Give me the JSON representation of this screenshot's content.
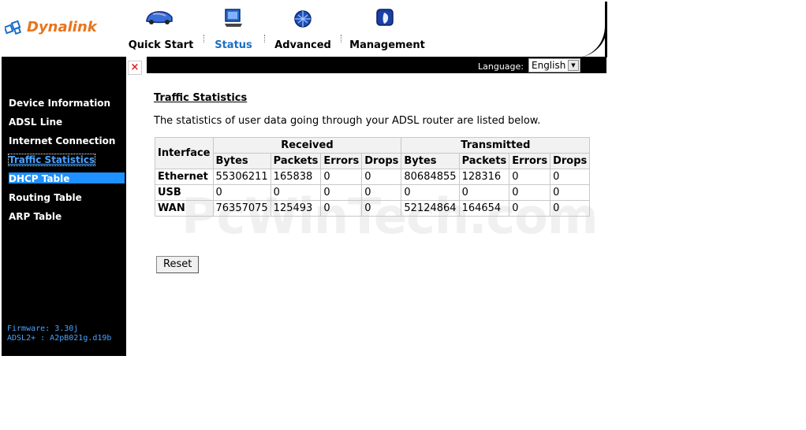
{
  "brand": {
    "name": "Dynalink"
  },
  "nav": {
    "items": [
      {
        "label": "Quick Start",
        "icon": "car-icon"
      },
      {
        "label": "Status",
        "icon": "monitor-icon",
        "active": true
      },
      {
        "label": "Advanced",
        "icon": "chip-icon"
      },
      {
        "label": "Management",
        "icon": "shield-icon"
      }
    ]
  },
  "language": {
    "label": "Language:",
    "selected": "English"
  },
  "sidebar": {
    "close": "×",
    "items": [
      {
        "label": "Device Information"
      },
      {
        "label": "ADSL Line"
      },
      {
        "label": "Internet Connection"
      },
      {
        "label": "Traffic Statistics"
      },
      {
        "label": "DHCP Table"
      },
      {
        "label": "Routing Table"
      },
      {
        "label": "ARP Table"
      }
    ],
    "firmware": "Firmware:  3.30j",
    "adsl": "ADSL2+ :  A2pB021g.d19b"
  },
  "main": {
    "title": "Traffic Statistics",
    "description": "The statistics of user data going through your ADSL router are listed below.",
    "table": {
      "interface_header": "Interface",
      "received_header": "Received",
      "transmitted_header": "Transmitted",
      "sub_headers": [
        "Bytes",
        "Packets",
        "Errors",
        "Drops",
        "Bytes",
        "Packets",
        "Errors",
        "Drops"
      ],
      "rows": [
        {
          "interface": "Ethernet",
          "values": [
            "55306211",
            "165838",
            "0",
            "0",
            "80684855",
            "128316",
            "0",
            "0"
          ]
        },
        {
          "interface": "USB",
          "values": [
            "0",
            "0",
            "0",
            "0",
            "0",
            "0",
            "0",
            "0"
          ]
        },
        {
          "interface": "WAN",
          "values": [
            "76357075",
            "125493",
            "0",
            "0",
            "52124864",
            "164654",
            "0",
            "0"
          ]
        }
      ]
    },
    "reset_label": "Reset"
  },
  "watermark": "PcWinTech.com",
  "colors": {
    "brand": "#e8741c",
    "active_nav": "#1b6fc6",
    "sidebar_current": "#4aa3ff",
    "hover": "#1e90ff"
  }
}
